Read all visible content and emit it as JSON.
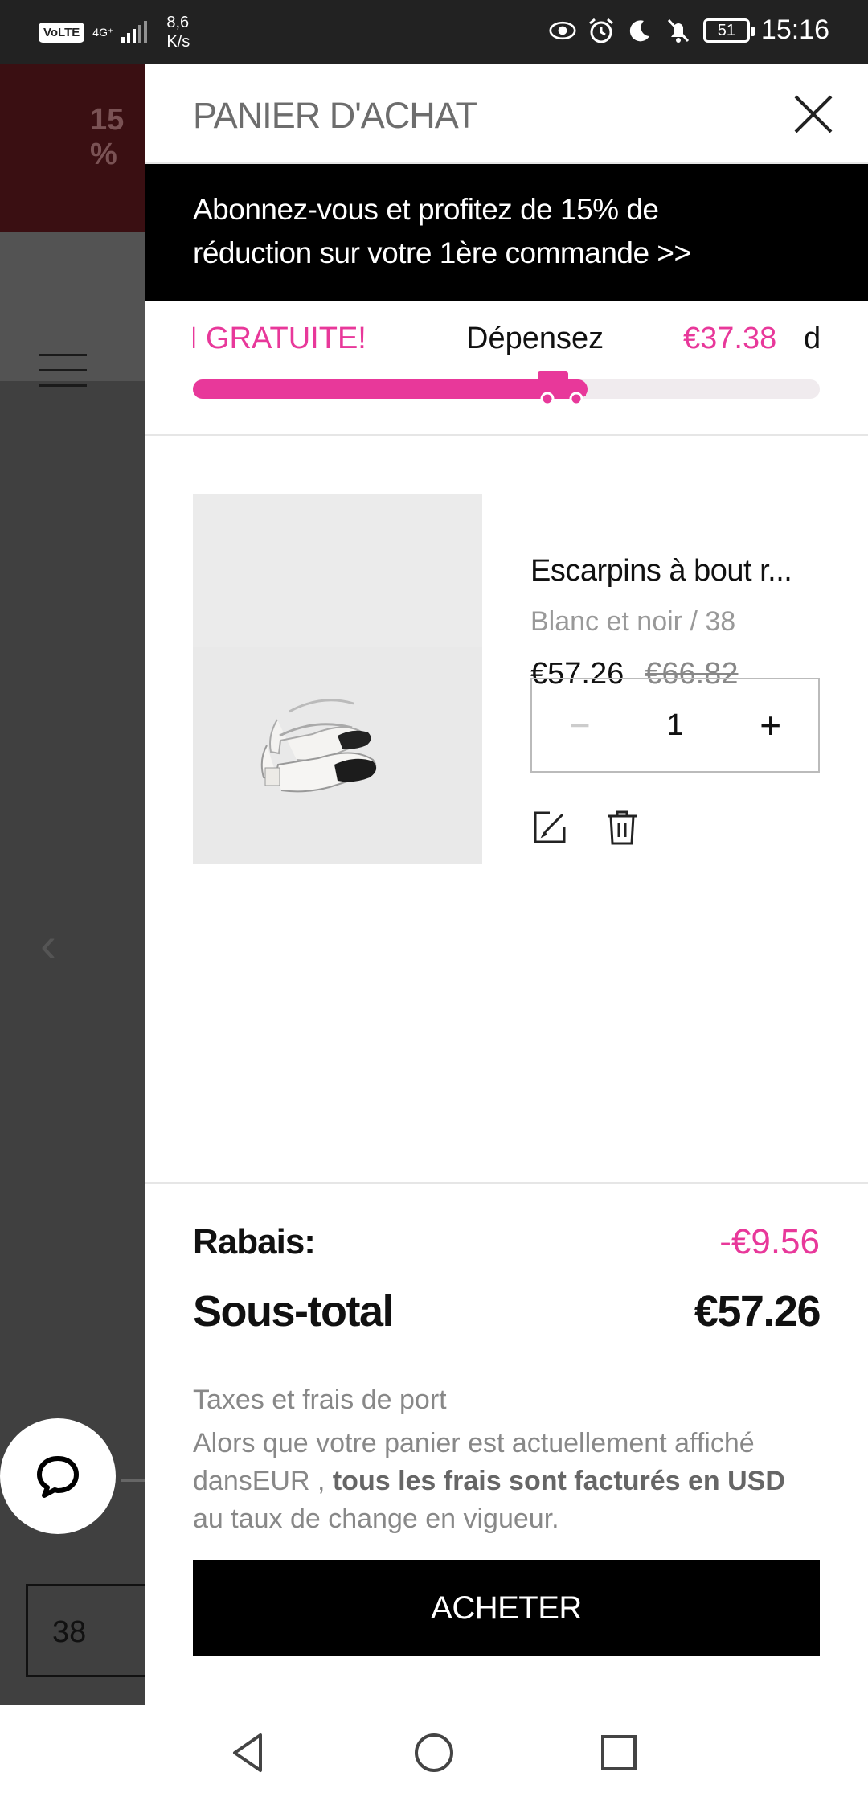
{
  "status_bar": {
    "volte": "VoLTE",
    "network": "4G⁺",
    "speed_value": "8,6",
    "speed_unit": "K/s",
    "battery": "51",
    "time": "15:16"
  },
  "background": {
    "banner_text": "15 %",
    "size_value": "38"
  },
  "cart": {
    "title": "PANIER D'ACHAT",
    "promo_line1": "Abonnez-vous et profitez de 15% de",
    "promo_line2": "réduction sur votre 1ère commande >>",
    "shipping": {
      "ticker_start": "N GRATUITE!",
      "spend_label": "Dépensez",
      "amount": "€37.38",
      "ticker_end": "de plus",
      "progress": 0.63,
      "accent": "#e8389a"
    },
    "item": {
      "name": "Escarpins à bout r...",
      "variant": "Blanc et noir / 38",
      "price": "€57.26",
      "old_price": "€66.82",
      "qty_minus": "−",
      "quantity": "1",
      "qty_plus": "+"
    },
    "summary": {
      "discount_label": "Rabais:",
      "discount_value": "-€9.56",
      "subtotal_label": "Sous-total",
      "subtotal_value": "€57.26",
      "taxes_title": "Taxes et frais de port",
      "note_start": "Alors que votre panier est actuellement affiché dansEUR , ",
      "note_bold": "tous les frais sont facturés en USD",
      "note_end": " au taux de change en vigueur.",
      "buy_label": "ACHETER"
    }
  }
}
